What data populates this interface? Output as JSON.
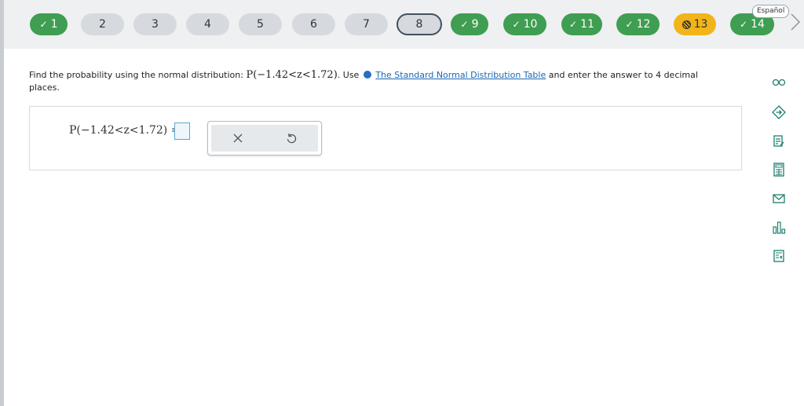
{
  "nav": {
    "questions": [
      {
        "label": "1",
        "status": "done"
      },
      {
        "label": "2",
        "status": "todo"
      },
      {
        "label": "3",
        "status": "todo"
      },
      {
        "label": "4",
        "status": "todo"
      },
      {
        "label": "5",
        "status": "todo"
      },
      {
        "label": "6",
        "status": "todo"
      },
      {
        "label": "7",
        "status": "todo"
      },
      {
        "label": "8",
        "status": "current"
      },
      {
        "label": "9",
        "status": "done"
      },
      {
        "label": "10",
        "status": "done"
      },
      {
        "label": "11",
        "status": "done"
      },
      {
        "label": "12",
        "status": "done"
      },
      {
        "label": "13",
        "status": "partial"
      },
      {
        "label": "14",
        "status": "done"
      }
    ],
    "language": "Español"
  },
  "question": {
    "text_before": "Find the probability using the normal distribution: ",
    "expr": "P(−1.42<z<1.72)",
    "text_use": ". Use ",
    "link": "The Standard Normal Distribution Table",
    "text_after": " and enter the answer to 4 decimal places."
  },
  "answer": {
    "equation": "P(−1.42<z<1.72) ="
  },
  "tools": {
    "clear_icon": "x-icon",
    "undo_icon": "undo-icon"
  },
  "sidebar_icons": [
    "glasses-icon",
    "compass-icon",
    "notes-icon",
    "calculator-icon",
    "mail-icon",
    "bar-chart-icon",
    "formula-sheet-icon"
  ],
  "colors": {
    "done": "#3f9e51",
    "todo": "#d6dadf",
    "partial": "#f2b418",
    "link": "#1a67b6",
    "sidebar_icon": "#1e7e6e"
  }
}
